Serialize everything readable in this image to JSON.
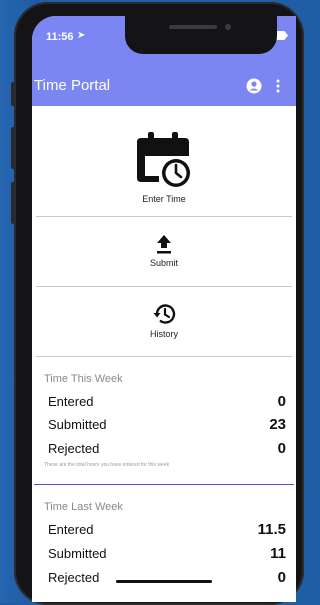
{
  "status": {
    "time": "11:56"
  },
  "app": {
    "title": "Time Portal"
  },
  "tiles": {
    "enter_time": "Enter Time",
    "submit": "Submit",
    "history": "History"
  },
  "this_week": {
    "title": "Time This Week",
    "rows": [
      {
        "label": "Entered",
        "value": "0"
      },
      {
        "label": "Submitted",
        "value": "23"
      },
      {
        "label": "Rejected",
        "value": "0"
      }
    ],
    "note": "These are the total hours you have entered for this week"
  },
  "last_week": {
    "title": "Time Last Week",
    "rows": [
      {
        "label": "Entered",
        "value": "11.5"
      },
      {
        "label": "Submitted",
        "value": "11"
      },
      {
        "label": "Rejected",
        "value": "0"
      }
    ]
  },
  "colors": {
    "accent": "#7b86f3",
    "divider_accent": "#5a4fcf",
    "background": "#1f5ea4"
  }
}
